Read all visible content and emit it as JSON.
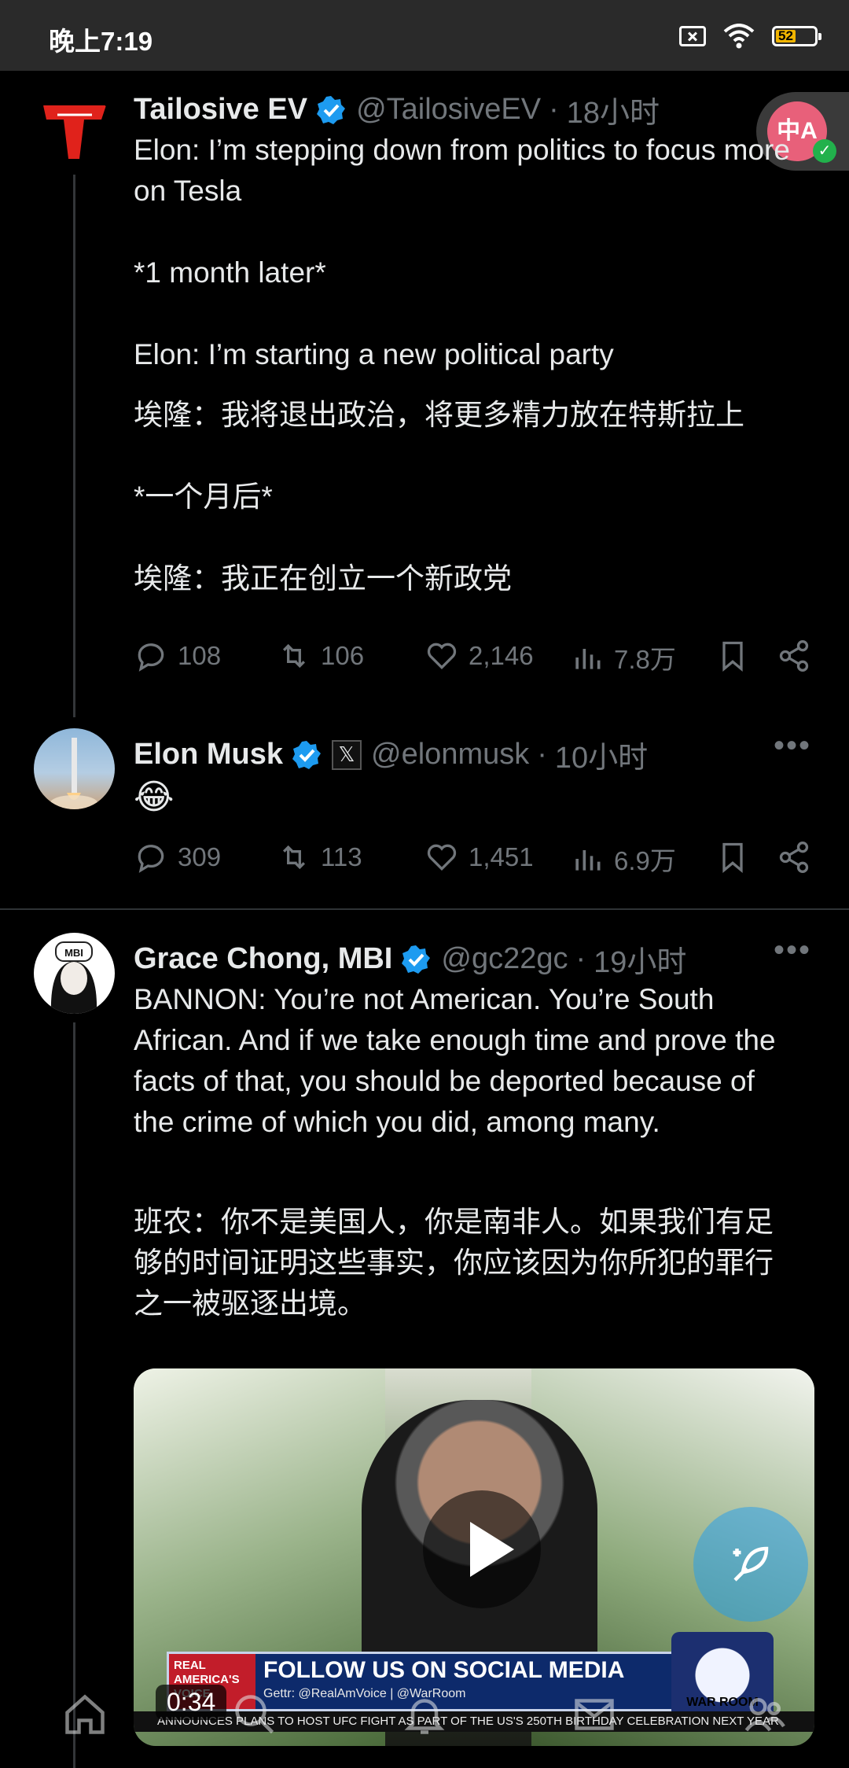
{
  "status_bar": {
    "time": "晚上7:19",
    "battery": "52"
  },
  "translate_fab": {
    "label": "中A"
  },
  "tweets": [
    {
      "display_name": "Tailosive EV",
      "handle": "@TailosiveEV",
      "time": "18小时",
      "body": "Elon: I’m stepping down from politics to focus more on Tesla\n\n*1 month later*\n\nElon: I’m starting a new political party",
      "translation": "埃隆：我将退出政治，将更多精力放在特斯拉上\n\n*一个月后*\n\n埃隆：我正在创立一个新政党",
      "replies": "108",
      "retweets": "106",
      "likes": "2,146",
      "views": "7.8万"
    },
    {
      "display_name": "Elon Musk",
      "handle": "@elonmusk",
      "time": "10小时",
      "body": "😂",
      "replies": "309",
      "retweets": "113",
      "likes": "1,451",
      "views": "6.9万"
    },
    {
      "display_name": "Grace Chong, MBI",
      "handle": "@gc22gc",
      "time": "19小时",
      "body": "BANNON: You’re not American. You’re South African. And if we take enough time and prove the facts of that, you should be deported because of the crime of which you did, among many.",
      "translation": "班农：你不是美国人，你是南非人。如果我们有足够的时间证明这些事实，你应该因为你所犯的罪行之一被驱逐出境。",
      "avatar_cap": "MBI",
      "video": {
        "duration": "0:34",
        "chyron_logo": "REAL AMERICA'S VOICE",
        "chyron_title": "FOLLOW US ON SOCIAL MEDIA",
        "chyron_sub": "Gettr: @RealAmVoice | @WarRoom",
        "ticker": "ANNOUNCES PLANS TO HOST UFC FIGHT AS PART OF THE US'S 250TH BIRTHDAY CELEBRATION NEXT YEAR",
        "warroom": "WAR ROOM"
      }
    }
  ],
  "icons": {
    "verified_color": "#1d9bf0",
    "accent": "#1d9bf0"
  }
}
